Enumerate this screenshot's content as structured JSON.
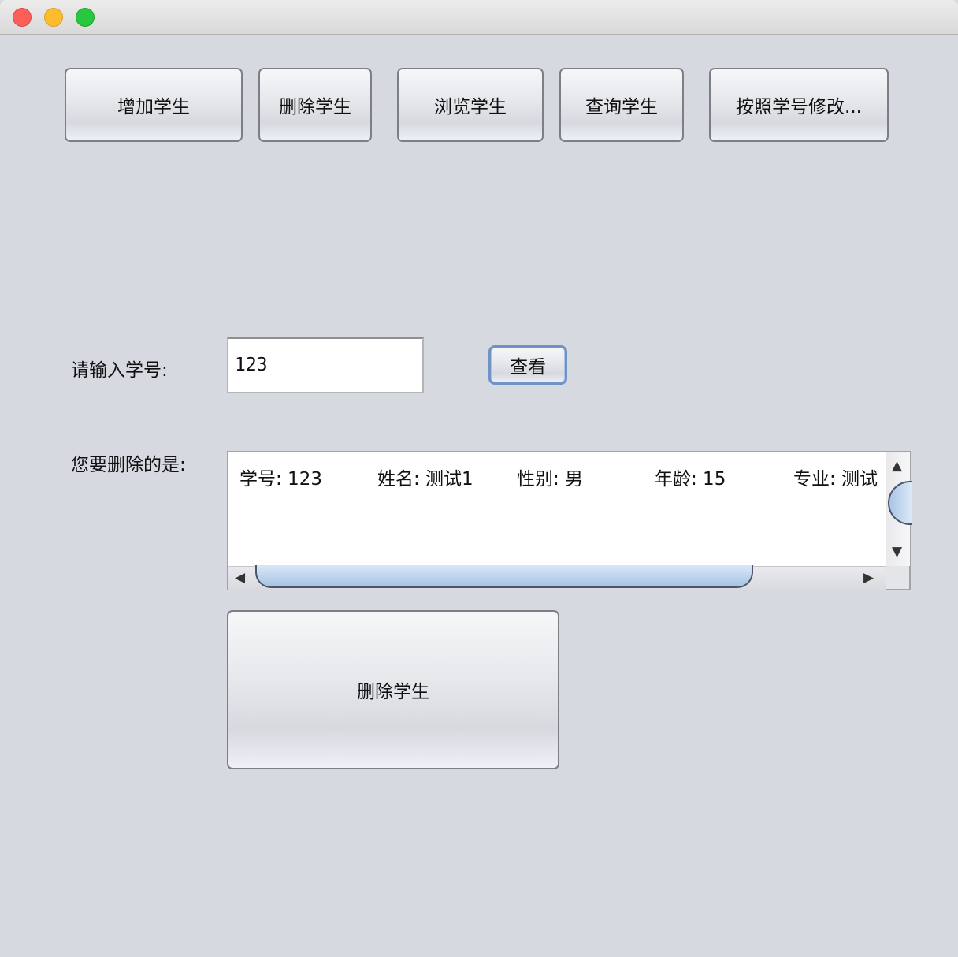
{
  "window": {
    "controls": [
      "close",
      "minimize",
      "maximize"
    ]
  },
  "toolbar": {
    "add": "增加学生",
    "delete": "删除学生",
    "browse": "浏览学生",
    "query": "查询学生",
    "modify": "按照学号修改..."
  },
  "form": {
    "id_label": "请输入学号:",
    "id_value": "123",
    "view_button": "查看",
    "result_label": "您要删除的是:",
    "result": {
      "id": "学号: 123",
      "name": "姓名: 测试1",
      "gender": "性别: 男",
      "age": "年龄: 15",
      "major": "专业: 测试"
    },
    "delete_button": "删除学生"
  },
  "scrollbars": {
    "up_arrow": "▲",
    "down_arrow": "▼",
    "left_arrow": "◀",
    "right_arrow": "▶"
  }
}
